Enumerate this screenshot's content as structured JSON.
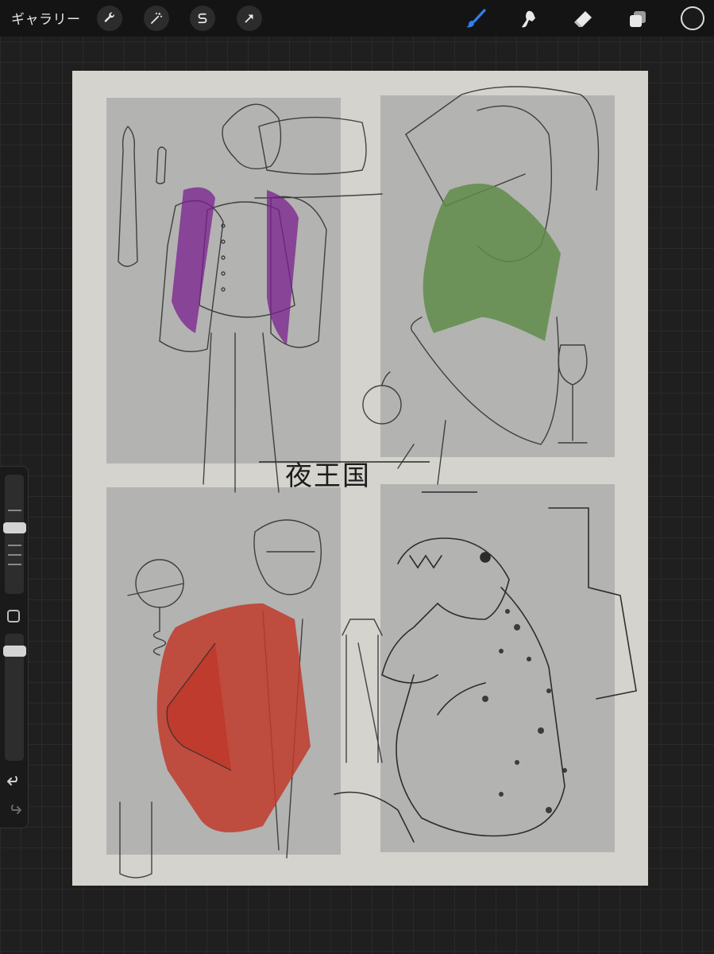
{
  "toolbar": {
    "gallery_label": "ギャラリー",
    "left_tools": [
      "wrench-icon",
      "magic-wand-icon",
      "selection-s-icon",
      "transform-arrow-icon"
    ],
    "right_tools": [
      "brush-icon",
      "smudge-icon",
      "eraser-icon",
      "layers-icon"
    ],
    "active_tool": "brush-icon",
    "current_color": "#1a1a1a",
    "accent_color": "#2f7ff5"
  },
  "sidebar": {
    "brush_size_level": 0.22,
    "opacity_level": 0.1,
    "buttons": [
      "modify-square-icon",
      "undo-icon",
      "redo-icon"
    ]
  },
  "canvas": {
    "title_text": "夜王国",
    "panels": [
      "top-left-host-panel",
      "top-right-woman-panel",
      "bottom-left-red-jacket-panel",
      "bottom-right-dinosaur-panel"
    ]
  }
}
